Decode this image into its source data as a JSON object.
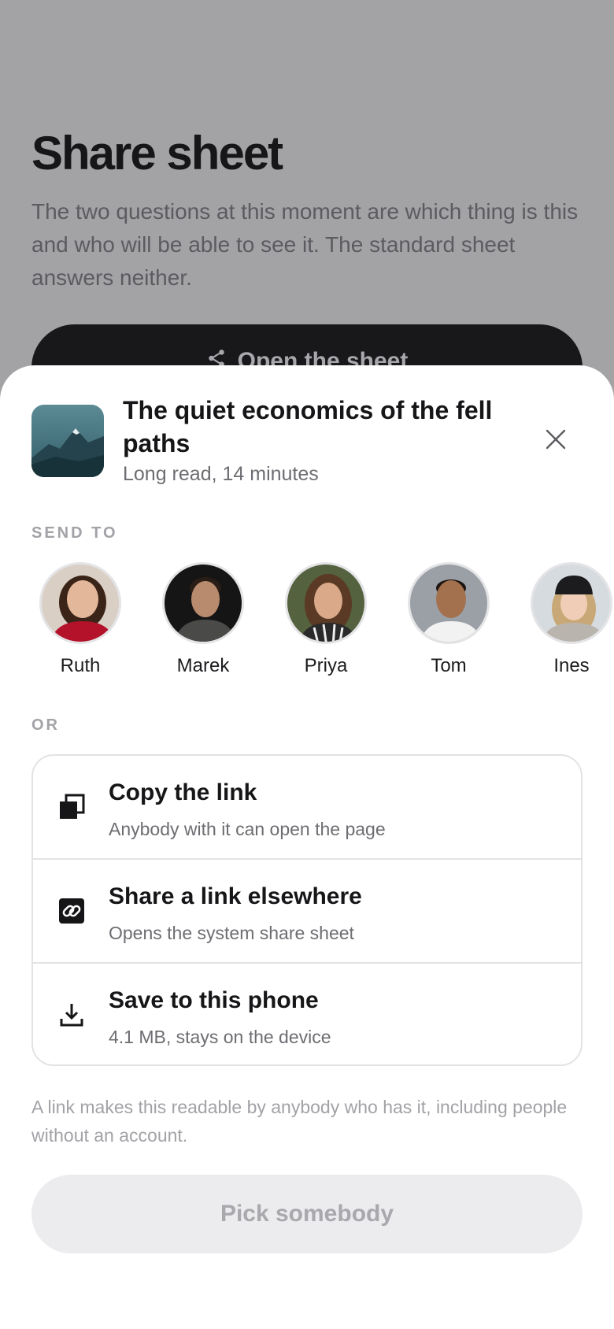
{
  "background": {
    "title": "Share sheet",
    "description": "The two questions at this moment are which thing is this and who will be able to see it. The standard sheet answers neither.",
    "button_label": "Open the sheet"
  },
  "sheet": {
    "item": {
      "title": "The quiet economics of the fell paths",
      "subtitle": "Long read, 14 minutes"
    },
    "send_to_label": "SEND TO",
    "contacts": [
      {
        "name": "Ruth"
      },
      {
        "name": "Marek"
      },
      {
        "name": "Priya"
      },
      {
        "name": "Tom"
      },
      {
        "name": "Ines"
      }
    ],
    "or_label": "OR",
    "options": [
      {
        "title": "Copy the link",
        "subtitle": "Anybody with it can open the page",
        "icon": "copy-icon"
      },
      {
        "title": "Share a link elsewhere",
        "subtitle": "Opens the system share sheet",
        "icon": "link-icon"
      },
      {
        "title": "Save to this phone",
        "subtitle": "4.1 MB, stays on the device",
        "icon": "download-icon"
      }
    ],
    "footnote": "A link makes this readable by anybody who has it, including people without an account.",
    "primary_button": "Pick somebody"
  },
  "colors": {
    "backdrop": "#a3a3a6",
    "sheet": "#ffffff",
    "text_primary": "#161618",
    "text_secondary": "#6d6d72",
    "disabled_button": "#ececee"
  }
}
